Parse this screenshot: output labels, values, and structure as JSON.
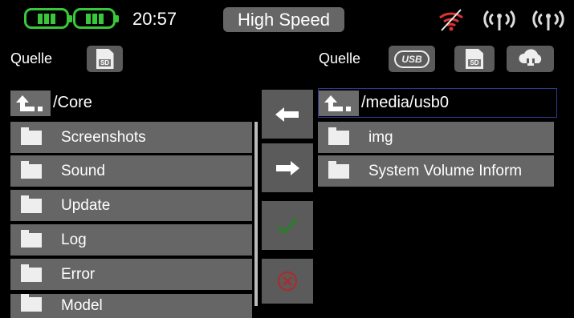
{
  "status": {
    "time": "20:57",
    "mode": "High Speed",
    "battery_color": "#38c83a"
  },
  "icons": {
    "battery1": "battery-icon",
    "battery2": "battery-icon",
    "wifi": "wifi-disabled-icon",
    "antenna1": "antenna-icon",
    "antenna2": "antenna-icon",
    "up": "folder-up-icon",
    "folder": "folder-icon",
    "arrow_left": "arrow-left-icon",
    "arrow_right": "arrow-right-icon",
    "confirm": "checkmark-icon",
    "cancel": "close-circle-icon",
    "cloud": "cloud-icon"
  },
  "left_panel": {
    "source_label": "Quelle",
    "sd_label": "SD",
    "path": "/Core",
    "items": [
      "Screenshots",
      "Sound",
      "Update",
      "Log",
      "Error",
      "Model"
    ]
  },
  "right_panel": {
    "source_label": "Quelle",
    "usb_label": "USB",
    "sd_label": "SD",
    "path": "/media/usb0",
    "items": [
      "img",
      "System Volume Inform"
    ]
  },
  "colors": {
    "background": "#000000",
    "button": "#5b5b5b",
    "row": "#666666",
    "confirm_green": "#2f7a2f",
    "cancel_red": "#a33030",
    "selection_border": "#2c3a8c"
  }
}
